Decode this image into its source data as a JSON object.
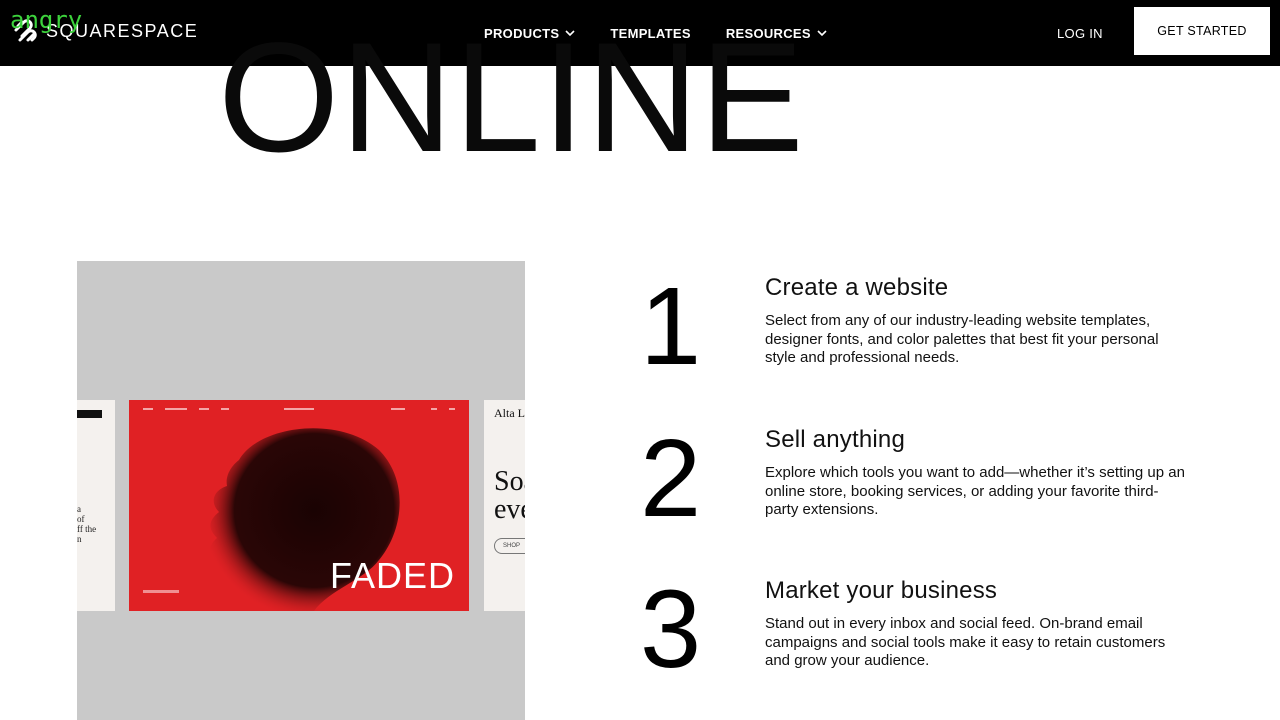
{
  "overlay": {
    "tag": "angry"
  },
  "nav": {
    "logo_text": "SQUARESPACE",
    "links": [
      {
        "label": "PRODUCTS",
        "has_dropdown": true
      },
      {
        "label": "TEMPLATES",
        "has_dropdown": false
      },
      {
        "label": "RESOURCES",
        "has_dropdown": true
      }
    ],
    "login_label": "LOG IN",
    "cta_label": "GET STARTED"
  },
  "hero": {
    "word": "ONLINE"
  },
  "mockup": {
    "left_card_text": "a\nof\nff the\nn",
    "main_card_caption": "FADED",
    "right_card_title": "Alta Le",
    "right_card_heading": "Soa\neve",
    "right_card_button": "SHOP"
  },
  "steps": [
    {
      "number": "1",
      "title": "Create a website",
      "description": "Select from any of our industry-leading website templates, designer fonts, and color palettes that best fit your personal style and professional needs."
    },
    {
      "number": "2",
      "title": "Sell anything",
      "description": "Explore which tools you want to add—whether it’s setting up an online store, booking services, or adding your favorite third-party extensions."
    },
    {
      "number": "3",
      "title": "Market your business",
      "description": "Stand out in every inbox and social feed. On-brand email campaigns and social tools make it easy to retain customers and grow your audience."
    }
  ],
  "colors": {
    "nav_bg": "#000000",
    "mock_bg": "#c9c9c9",
    "card_red": "#e02124",
    "overlay_green": "#3cd23c"
  }
}
